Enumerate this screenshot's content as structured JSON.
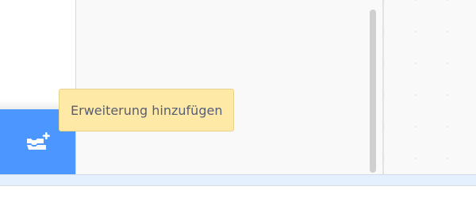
{
  "tooltip": {
    "text": "Erweiterung hinzufügen"
  },
  "add_extension": {
    "icon": "add-extension-icon",
    "color": "#4c97ff"
  },
  "colors": {
    "palette_background": "#f9f9f9",
    "tooltip_background": "#ffe9a6",
    "tooltip_text": "#575e75",
    "bottom_bar_tint": "#e5f0ff"
  }
}
